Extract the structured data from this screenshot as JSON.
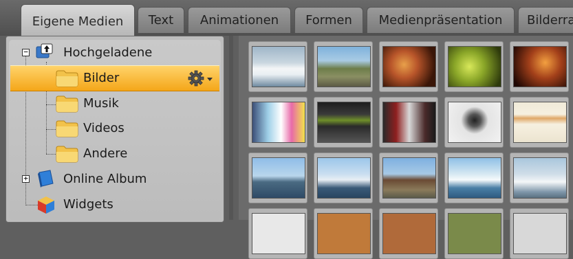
{
  "tabs": [
    {
      "label": "Eigene Medien",
      "active": true
    },
    {
      "label": "Text"
    },
    {
      "label": "Animationen"
    },
    {
      "label": "Formen"
    },
    {
      "label": "Medienpräsentation"
    },
    {
      "label": "Bilderra"
    }
  ],
  "tree": {
    "root": "Hochgeladene",
    "children": [
      "Bilder",
      "Musik",
      "Videos",
      "Andere"
    ],
    "selected": "Bilder",
    "online_album": "Online Album",
    "widgets": "Widgets"
  },
  "gallery": {
    "thumbnails": [
      {
        "subject": "iceberg"
      },
      {
        "subject": "hikers on hill"
      },
      {
        "subject": "crowd party"
      },
      {
        "subject": "green light"
      },
      {
        "subject": "stage lights"
      },
      {
        "subject": "website screenshot"
      },
      {
        "subject": "software screenshot"
      },
      {
        "subject": "website screenshot dark"
      },
      {
        "subject": "silhouette art"
      },
      {
        "subject": "profile page"
      },
      {
        "subject": "harbor town"
      },
      {
        "subject": "icebergs at sea"
      },
      {
        "subject": "church village"
      },
      {
        "subject": "ice cliff"
      },
      {
        "subject": "iceberg close"
      }
    ]
  },
  "colors": {
    "selection": "#f4a619",
    "folder": "#f2c24a"
  }
}
